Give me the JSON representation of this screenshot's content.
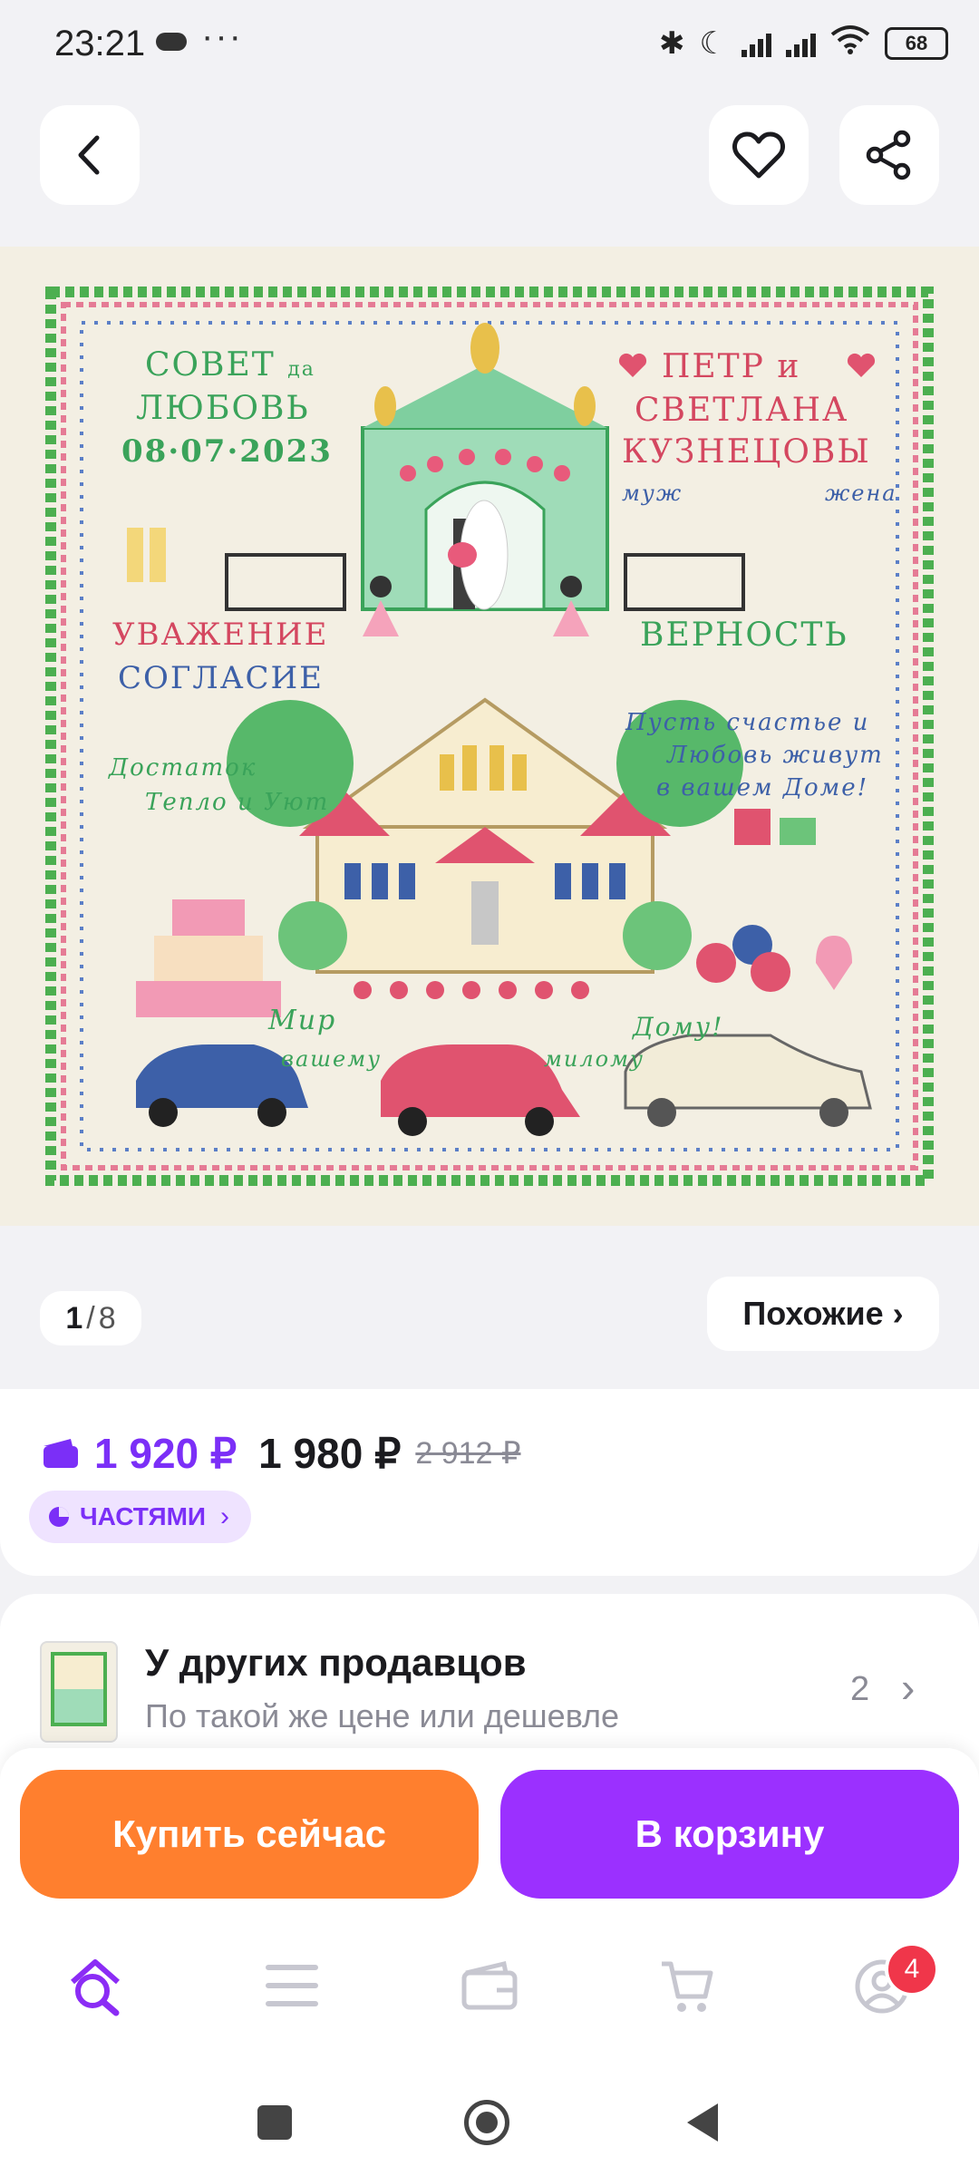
{
  "status_bar": {
    "time": "23:21",
    "dots": "···",
    "battery": "68"
  },
  "header": {
    "back_icon": "chevron-left-icon",
    "favorite_icon": "heart-outline-icon",
    "share_icon": "share-icon"
  },
  "product_image": {
    "texts": {
      "sovet": "СОВЕТ",
      "da": "да",
      "lyubov": "ЛЮБОВЬ",
      "date": "08·07·2023",
      "petr": "ПЕТР и",
      "svetlana": "СВЕТЛАНА",
      "kuznetsovy": "КУЗНЕЦОВЫ",
      "muzh": "муж",
      "zhena": "жена",
      "uvazhenie": "УВАЖЕНИЕ",
      "soglasie": "СОГЛАСИЕ",
      "vernost": "ВЕРНОСТЬ",
      "wish_1": "Пусть счастье и",
      "wish_2": "Любовь живут",
      "wish_3": "в вашем Доме!",
      "dostatok": "Достаток",
      "teplo": "Тепло и Уют",
      "mir": "Мир",
      "vashemu": "вашему",
      "milomu": "милому",
      "domu": "Дому!"
    }
  },
  "gallery": {
    "current": "1",
    "separator": "/",
    "total": "8",
    "similar_label": "Похожие ›"
  },
  "price": {
    "card_price": "1 920 ₽",
    "price": "1 980 ₽",
    "old_price": "2 912 ₽",
    "installments_label": "ЧАСТЯМИ",
    "accent_color": "#7b2ff7"
  },
  "other_sellers": {
    "title": "У других продавцов",
    "subtitle": "По такой же цене или дешевле",
    "count": "2"
  },
  "actions": {
    "buy_now": "Купить сейчас",
    "add_to_cart": "В корзину",
    "buy_color": "#ff7f2e",
    "cart_color": "#9b30ff"
  },
  "bottom_nav": {
    "items": [
      {
        "icon": "search-home-icon",
        "active": true
      },
      {
        "icon": "catalog-menu-icon",
        "active": false
      },
      {
        "icon": "wallet-icon",
        "active": false
      },
      {
        "icon": "cart-icon",
        "active": false
      },
      {
        "icon": "profile-icon",
        "badge": "4",
        "active": false
      }
    ]
  }
}
